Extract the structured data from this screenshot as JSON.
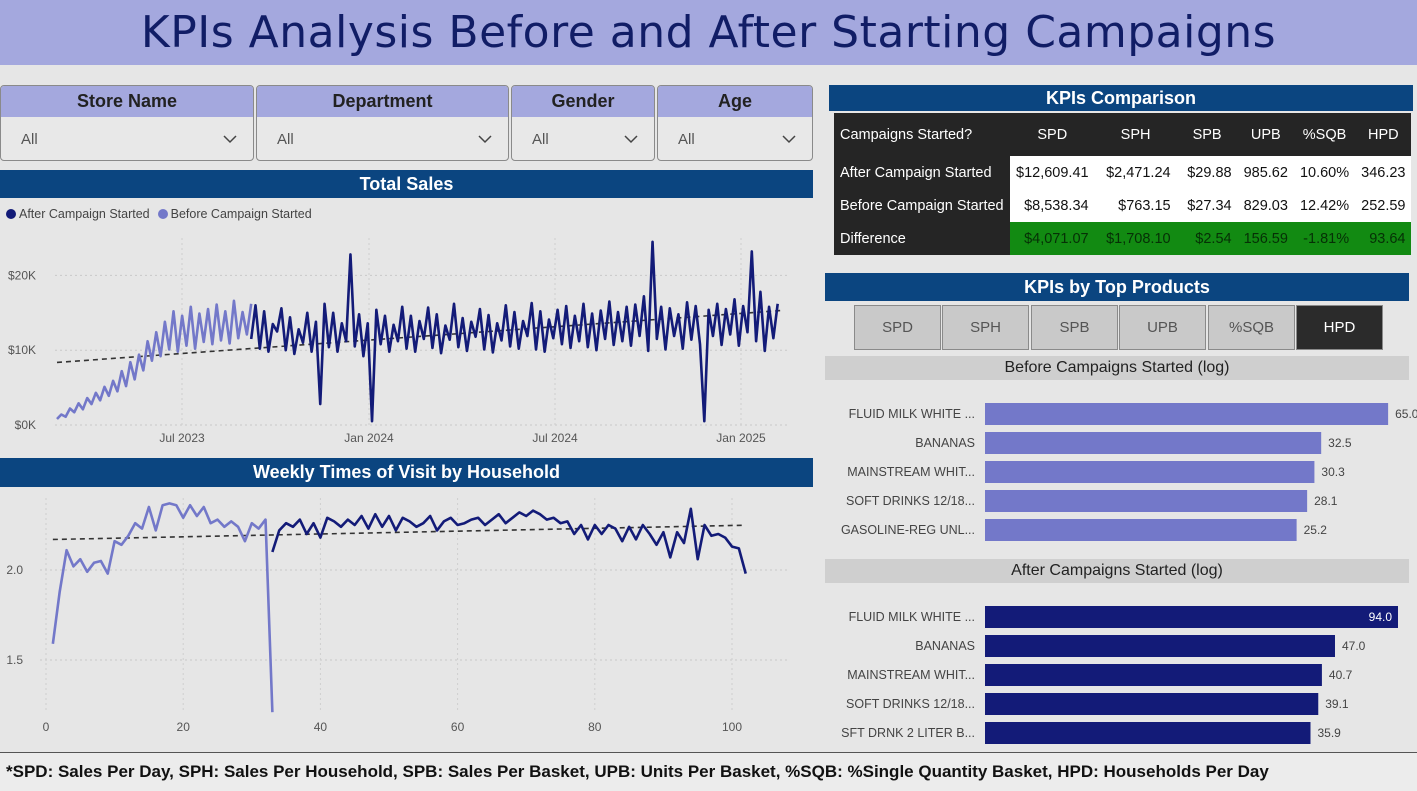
{
  "page_title": "KPIs Analysis Before and After Starting Campaigns",
  "slicers": [
    {
      "label": "Store Name",
      "value": "All"
    },
    {
      "label": "Department",
      "value": "All"
    },
    {
      "label": "Gender",
      "value": "All"
    },
    {
      "label": "Age",
      "value": "All"
    }
  ],
  "total_sales": {
    "title": "Total Sales",
    "legend": [
      "After Campaign Started",
      "Before Campaign Started"
    ]
  },
  "weekly_visits": {
    "title": "Weekly Times of Visit by Household"
  },
  "kpi_comparison": {
    "title": "KPIs Comparison",
    "columns": [
      "Campaigns Started?",
      "SPD",
      "SPH",
      "SPB",
      "UPB",
      "%SQB",
      "HPD"
    ],
    "rows": [
      [
        "After Campaign Started",
        "$12,609.41",
        "$2,471.24",
        "$29.88",
        "985.62",
        "10.60%",
        "346.23"
      ],
      [
        "Before Campaign Started",
        "$8,538.34",
        "$763.15",
        "$27.34",
        "829.03",
        "12.42%",
        "252.59"
      ],
      [
        "Difference",
        "$4,071.07",
        "$1,708.10",
        "$2.54",
        "156.59",
        "-1.81%",
        "93.64"
      ]
    ]
  },
  "top_products": {
    "title": "KPIs by Top Products",
    "buttons": [
      "SPD",
      "SPH",
      "SPB",
      "UPB",
      "%SQB",
      "HPD"
    ],
    "active_button": "HPD",
    "before_title": "Before Campaigns Started (log)",
    "after_title": "After Campaigns Started (log)"
  },
  "footer_note": "*SPD: Sales Per Day, SPH: Sales Per Household, SPB: Sales Per Basket, UPB: Units Per Basket, %SQB: %Single Quantity Basket, HPD: Households Per Day",
  "colors": {
    "after": "#131b78",
    "before": "#7378c9",
    "header_bg": "#a4a8de",
    "title_bar": "#0b4580",
    "difference": "#128a12"
  },
  "chart_data": [
    {
      "type": "line",
      "title": "Total Sales",
      "x_ticks": [
        "Jul 2023",
        "Jan 2024",
        "Jul 2024",
        "Jan 2025"
      ],
      "y_ticks": [
        "$0K",
        "$10K",
        "$20K"
      ],
      "ylim": [
        0,
        25000
      ],
      "trendline": true,
      "series": [
        {
          "name": "Before Campaign Started",
          "color": "#7378c9",
          "values": [
            800,
            1400,
            1100,
            2200,
            1700,
            2900,
            2100,
            3600,
            2800,
            4300,
            3300,
            5100,
            3900,
            5900,
            4500,
            7200,
            5200,
            8400,
            6100,
            9400,
            7300,
            11200,
            8600,
            12400,
            9200,
            13800,
            10100,
            15200,
            9800,
            14600,
            10600,
            15800,
            10200,
            14900,
            11100,
            15500,
            10800,
            16100,
            11300,
            15200,
            10900,
            16600,
            11600,
            15100,
            12100,
            16200
          ]
        },
        {
          "name": "After Campaign Started",
          "color": "#131b78",
          "values": [
            11500,
            16000,
            10200,
            15200,
            9800,
            13500,
            12500,
            15600,
            10000,
            14400,
            9500,
            12800,
            11000,
            15000,
            9800,
            13800,
            2800,
            16200,
            10400,
            15000,
            9800,
            13600,
            11200,
            22800,
            10500,
            14800,
            9200,
            13600,
            500,
            15400,
            10800,
            14600,
            9800,
            13400,
            11200,
            15800,
            10200,
            14600,
            9800,
            13900,
            11500,
            15700,
            10300,
            14800,
            9600,
            13300,
            11400,
            16200,
            10400,
            14300,
            9900,
            13800,
            11800,
            15500,
            10100,
            14700,
            9700,
            13600,
            11300,
            16000,
            10500,
            15100,
            10200,
            13900,
            11900,
            16300,
            10100,
            15200,
            9800,
            14100,
            11600,
            15400,
            10800,
            15900,
            10300,
            14600,
            11200,
            16200,
            10400,
            14900,
            10000,
            15300,
            11500,
            16500,
            10700,
            15100,
            11200,
            15800,
            10600,
            16100,
            11900,
            17200,
            9900,
            24500,
            11500,
            15800,
            10100,
            15600,
            11900,
            14800,
            10200,
            16400,
            11400,
            15900,
            10800,
            500,
            15400,
            11900,
            16200,
            10700,
            15500,
            12100,
            16800,
            10600,
            15900,
            12400,
            23200,
            11200,
            17800,
            9900,
            15800,
            11600,
            16200
          ]
        }
      ]
    },
    {
      "type": "line",
      "title": "Weekly Times of Visit by Household",
      "x_ticks": [
        0,
        20,
        40,
        60,
        80,
        100
      ],
      "y_ticks": [
        1.5,
        2.0
      ],
      "trendline": true,
      "series": [
        {
          "name": "Before Campaign Started",
          "color": "#7378c9",
          "x": [
            1,
            2,
            3,
            4,
            5,
            6,
            7,
            8,
            9,
            10,
            11,
            12,
            13,
            14,
            15,
            16,
            17,
            18,
            19,
            20,
            21,
            22,
            23,
            24,
            25,
            26,
            27,
            28,
            29,
            30,
            31,
            32,
            33
          ],
          "values": [
            1.59,
            1.88,
            2.11,
            2.02,
            2.06,
            1.99,
            2.04,
            2.05,
            1.98,
            2.16,
            2.14,
            2.19,
            2.26,
            2.23,
            2.35,
            2.22,
            2.36,
            2.37,
            2.36,
            2.29,
            2.36,
            2.3,
            2.35,
            2.26,
            2.28,
            2.24,
            2.27,
            2.24,
            2.16,
            2.26,
            2.23,
            2.28,
            1.21
          ]
        },
        {
          "name": "After Campaign Started",
          "color": "#131b78",
          "x": [
            33,
            34,
            35,
            36,
            37,
            38,
            39,
            40,
            41,
            42,
            43,
            44,
            45,
            46,
            47,
            48,
            49,
            50,
            51,
            52,
            53,
            54,
            55,
            56,
            57,
            58,
            59,
            60,
            61,
            62,
            63,
            64,
            65,
            66,
            67,
            68,
            69,
            70,
            71,
            72,
            73,
            74,
            75,
            76,
            77,
            78,
            79,
            80,
            81,
            82,
            83,
            84,
            85,
            86,
            87,
            88,
            89,
            90,
            91,
            92,
            93,
            94,
            95,
            96,
            97,
            98,
            99,
            100,
            101,
            102
          ],
          "values": [
            2.1,
            2.22,
            2.26,
            2.24,
            2.28,
            2.2,
            2.26,
            2.18,
            2.29,
            2.27,
            2.24,
            2.28,
            2.25,
            2.3,
            2.23,
            2.31,
            2.24,
            2.3,
            2.22,
            2.29,
            2.27,
            2.24,
            2.26,
            2.3,
            2.22,
            2.27,
            2.29,
            2.25,
            2.26,
            2.28,
            2.29,
            2.25,
            2.28,
            2.31,
            2.26,
            2.29,
            2.32,
            2.3,
            2.33,
            2.31,
            2.28,
            2.29,
            2.26,
            2.27,
            2.2,
            2.25,
            2.17,
            2.25,
            2.2,
            2.25,
            2.23,
            2.16,
            2.24,
            2.17,
            2.25,
            2.2,
            2.14,
            2.21,
            2.07,
            2.21,
            2.15,
            2.34,
            2.06,
            2.25,
            2.19,
            2.2,
            2.18,
            2.13,
            2.12,
            1.98
          ]
        }
      ]
    },
    {
      "type": "bar",
      "title": "Before Campaigns Started (log)",
      "categories": [
        "FLUID MILK WHITE ...",
        "BANANAS",
        "MAINSTREAM WHIT...",
        "SOFT DRINKS 12/18...",
        "GASOLINE-REG UNL..."
      ],
      "values": [
        65.0,
        32.5,
        30.3,
        28.1,
        25.2
      ],
      "color": "#7378c9"
    },
    {
      "type": "bar",
      "title": "After Campaigns Started (log)",
      "categories": [
        "FLUID MILK WHITE ...",
        "BANANAS",
        "MAINSTREAM WHIT...",
        "SOFT DRINKS 12/18...",
        "SFT DRNK 2 LITER B..."
      ],
      "values": [
        94.0,
        47.0,
        40.7,
        39.1,
        35.9
      ],
      "color": "#131b78"
    }
  ]
}
